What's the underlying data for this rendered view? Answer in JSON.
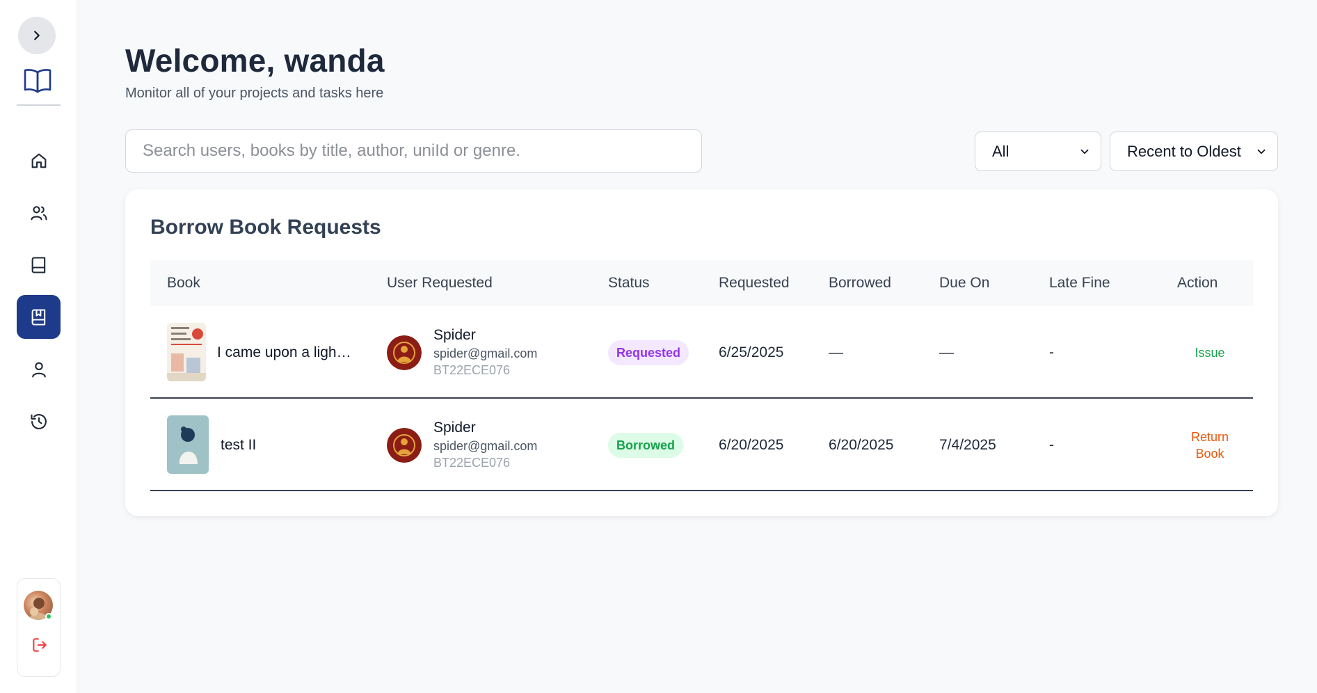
{
  "sidebar": {
    "toggle_icon": "chevron-right-icon",
    "logo_icon": "open-book-icon",
    "nav": [
      {
        "name": "home",
        "icon": "home-icon",
        "active": false
      },
      {
        "name": "users",
        "icon": "users-icon",
        "active": false
      },
      {
        "name": "books",
        "icon": "book-icon",
        "active": false
      },
      {
        "name": "borrow-requests",
        "icon": "book-bookmark-icon",
        "active": true
      },
      {
        "name": "account",
        "icon": "user-icon",
        "active": false
      },
      {
        "name": "history",
        "icon": "history-icon",
        "active": false
      }
    ],
    "logout_icon": "logout-icon"
  },
  "header": {
    "title": "Welcome, wanda",
    "subtitle": "Monitor all of your projects and tasks here"
  },
  "search": {
    "placeholder": "Search users, books by title, author, uniId or genre.",
    "value": ""
  },
  "filters": {
    "status_selected": "All",
    "sort_selected": "Recent to Oldest"
  },
  "table": {
    "title": "Borrow Book Requests",
    "columns": [
      "Book",
      "User Requested",
      "Status",
      "Requested",
      "Borrowed",
      "Due On",
      "Late Fine",
      "Action"
    ],
    "rows": [
      {
        "book_title": "I came upon a ligh…",
        "user_name": "Spider",
        "user_email": "spider@gmail.com",
        "user_id": "BT22ECE076",
        "status": "Requested",
        "requested": "6/25/2025",
        "borrowed": "—",
        "due_on": "—",
        "late_fine": "-",
        "action": "Issue"
      },
      {
        "book_title": "test II",
        "user_name": "Spider",
        "user_email": "spider@gmail.com",
        "user_id": "BT22ECE076",
        "status": "Borrowed",
        "requested": "6/20/2025",
        "borrowed": "6/20/2025",
        "due_on": "7/4/2025",
        "late_fine": "-",
        "action": "Return Book"
      }
    ]
  },
  "colors": {
    "accent": "#1e3a8a",
    "requested": "#9333ea",
    "borrowed": "#16a34a",
    "return": "#ea580c",
    "logout": "#ef4444"
  }
}
